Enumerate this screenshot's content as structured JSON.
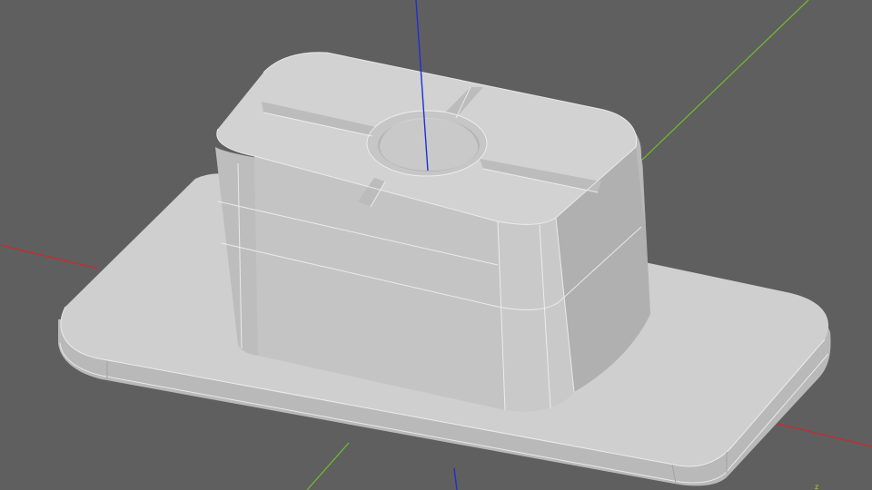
{
  "viewport": {
    "background_color": "#5f5f5f"
  },
  "axes": {
    "x_axis_color": "#cc2a2a",
    "y_axis_color": "#6fc02a",
    "z_axis_color": "#1f2fd6"
  },
  "model": {
    "face_top_color": "#cfcfcf",
    "face_front_color": "#c0c0c0",
    "face_side_color": "#b3b3b3",
    "face_shadow_color": "#a8a8a8",
    "edge_color": "#f2f2f2"
  },
  "triad": {
    "glyph": "z"
  }
}
